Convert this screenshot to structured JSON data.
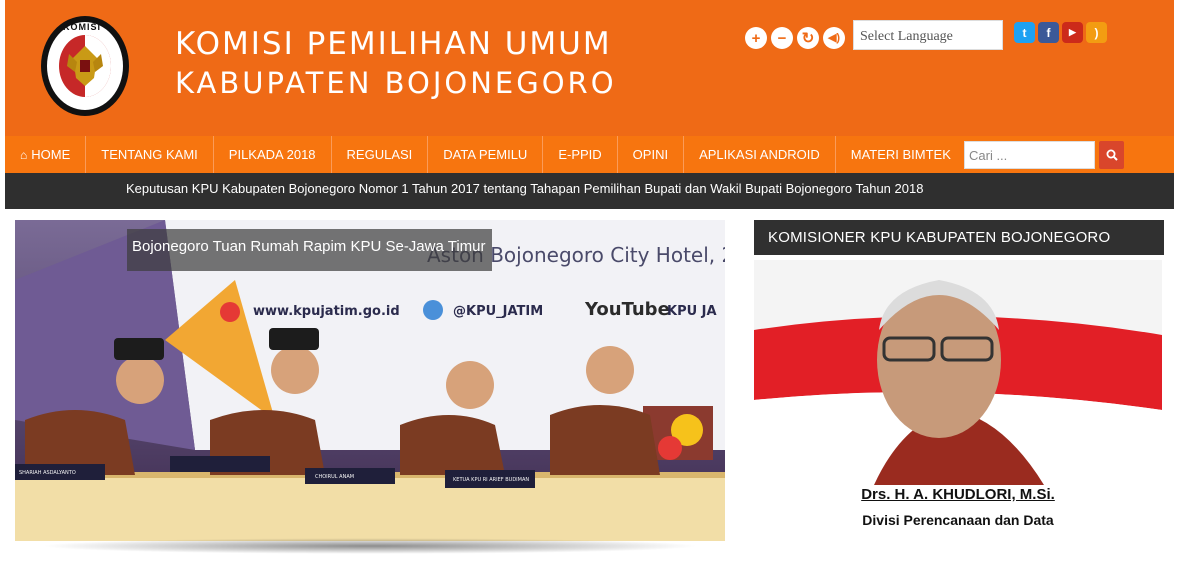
{
  "header": {
    "logo_top_text": "KOMISI",
    "logo_bottom_text": "PEMILIHAN UMUM",
    "title_line1": "KOMISI PEMILIHAN UMUM",
    "title_line2": "KABUPATEN BOJONEGORO",
    "accessibility": [
      {
        "icon": "plus-icon",
        "glyph": "+"
      },
      {
        "icon": "minus-icon",
        "glyph": "−"
      },
      {
        "icon": "refresh-icon",
        "glyph": "↻"
      },
      {
        "icon": "speaker-icon",
        "glyph": "🔊"
      }
    ],
    "language_select": "Select Language",
    "social": [
      {
        "icon": "twitter-icon",
        "glyph": "t",
        "color": "#1da1f2"
      },
      {
        "icon": "facebook-icon",
        "glyph": "f",
        "color": "#3b5998"
      },
      {
        "icon": "youtube-icon",
        "glyph": "▶",
        "color": "#cc2a1a"
      },
      {
        "icon": "rss-icon",
        "glyph": ")",
        "color": "#f39c12"
      }
    ]
  },
  "nav": {
    "items": [
      "HOME",
      "TENTANG KAMI",
      "PILKADA 2018",
      "REGULASI",
      "DATA PEMILU",
      "E-PPID",
      "OPINI",
      "APLIKASI ANDROID",
      "MATERI BIMTEK"
    ],
    "home_icon": "home-icon",
    "search_placeholder": "Cari ...",
    "search_icon": "search-icon"
  },
  "ticker": {
    "text": "Keputusan KPU Kabupaten Bojonegoro Nomor 1 Tahun 2017 tentang Tahapan Pemilihan Bupati dan Wakil Bupati Bojonegoro Tahun 2018"
  },
  "slider": {
    "caption": "Bojonegoro Tuan Rumah Rapim KPU Se-Jawa Timur",
    "banner_venue": "Aston Bojonegoro City Hotel, 2",
    "banner_site": "www.kpujatim.go.id",
    "banner_twitter": "@KPU_JATIM",
    "banner_youtube": "YouTube",
    "banner_channel": "KPU JA",
    "placards": [
      "SHARIAH ASDALYANTO",
      "",
      "CHOIRUL ANAM",
      "KETUA KPU RI ARIEF BUDIMAN"
    ]
  },
  "sidebar": {
    "widget_title": "KOMISIONER KPU KABUPATEN BOJONEGORO",
    "name": "Drs. H. A. KHUDLORI, M.Si.",
    "division": "Divisi Perencanaan dan Data"
  },
  "colors": {
    "header": "#ef6a16",
    "nav": "#f7750f",
    "ticker": "#2f2f2f",
    "widget_title": "#303030",
    "search_button": "#d9462b"
  }
}
